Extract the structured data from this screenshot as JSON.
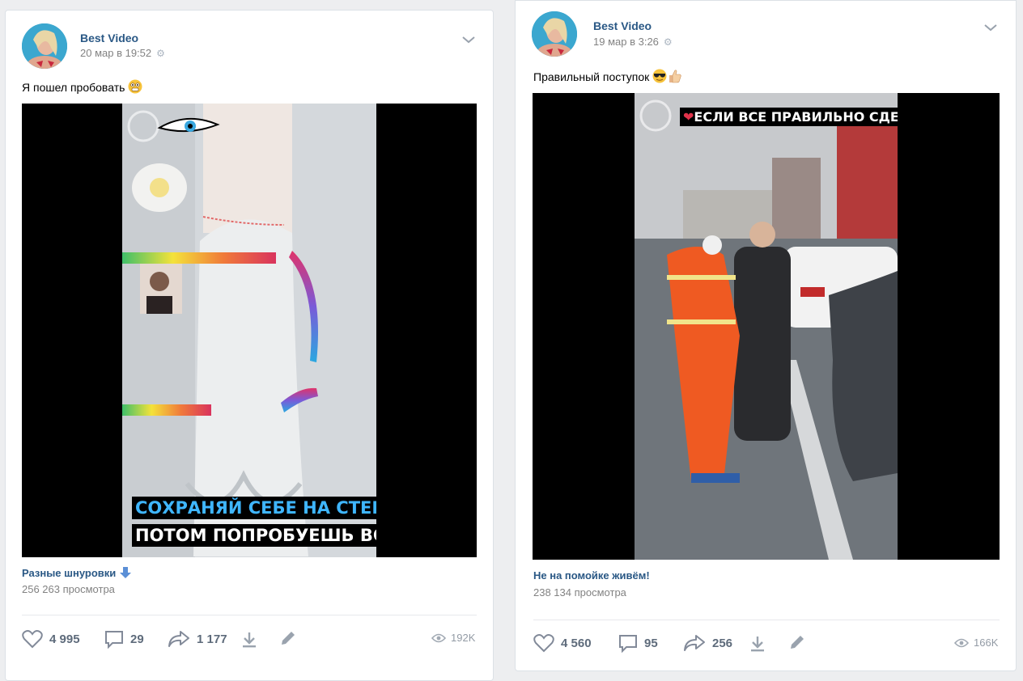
{
  "posts": [
    {
      "author": "Best Video",
      "date": "20 мар в 19:52",
      "text": "Я пошел пробовать",
      "video_title": "Разные шнуровки",
      "video_views": "256 263 просмотра",
      "video_caption_line1": "СОХРАНЯЙ СЕБЕ НА СТЕНУ",
      "video_caption_line2": "ПОТОМ ПОПРОБУЕШЬ ВСЕ",
      "likes": "4 995",
      "comments": "29",
      "shares": "1 177",
      "views": "192K"
    },
    {
      "author": "Best Video",
      "date": "19 мар в 3:26",
      "text": "Правильный поступок",
      "video_title": "Не на помойке живём!",
      "video_views": "238 134 просмотра",
      "video_caption": "ЕСЛИ ВСЕ ПРАВИЛЬНО СДЕЛАЛ!",
      "likes": "4 560",
      "comments": "95",
      "shares": "256",
      "views": "166K"
    }
  ],
  "icons": {
    "like": "heart-icon",
    "comment": "comment-icon",
    "share": "share-icon",
    "download": "download-icon",
    "edit": "pencil-icon",
    "views": "eye-icon",
    "settings": "gear-icon",
    "menu": "chevron-down-icon"
  },
  "colors": {
    "link": "#2a5885",
    "muted": "#828282",
    "background": "#edeef0",
    "card": "#ffffff"
  }
}
